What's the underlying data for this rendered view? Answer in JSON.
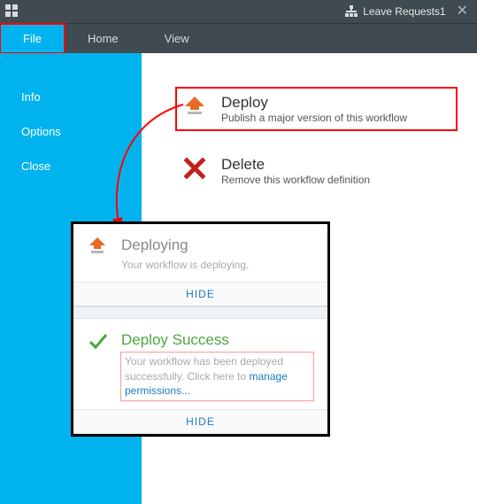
{
  "topbar": {
    "doc_title": "Leave Requests1"
  },
  "tabs": {
    "file": "File",
    "home": "Home",
    "view": "View"
  },
  "sidebar": {
    "info": "Info",
    "options": "Options",
    "close": "Close"
  },
  "actions": {
    "deploy": {
      "title": "Deploy",
      "subtitle": "Publish a major version of this workflow"
    },
    "delete": {
      "title": "Delete",
      "subtitle": "Remove this workflow definition"
    }
  },
  "panels": {
    "deploying": {
      "title": "Deploying",
      "message": "Your workflow is deploying.",
      "hide": "HIDE"
    },
    "success": {
      "title": "Deploy Success",
      "message_pre": "Your workflow has been deployed successfully. Click here to ",
      "link": "manage permissions...",
      "hide": "HIDE"
    }
  },
  "colors": {
    "accent": "#00b3ee",
    "highlight": "#ff0000",
    "success": "#4aa63f",
    "deploy_orange": "#e76a25",
    "delete_red": "#c4201d"
  }
}
